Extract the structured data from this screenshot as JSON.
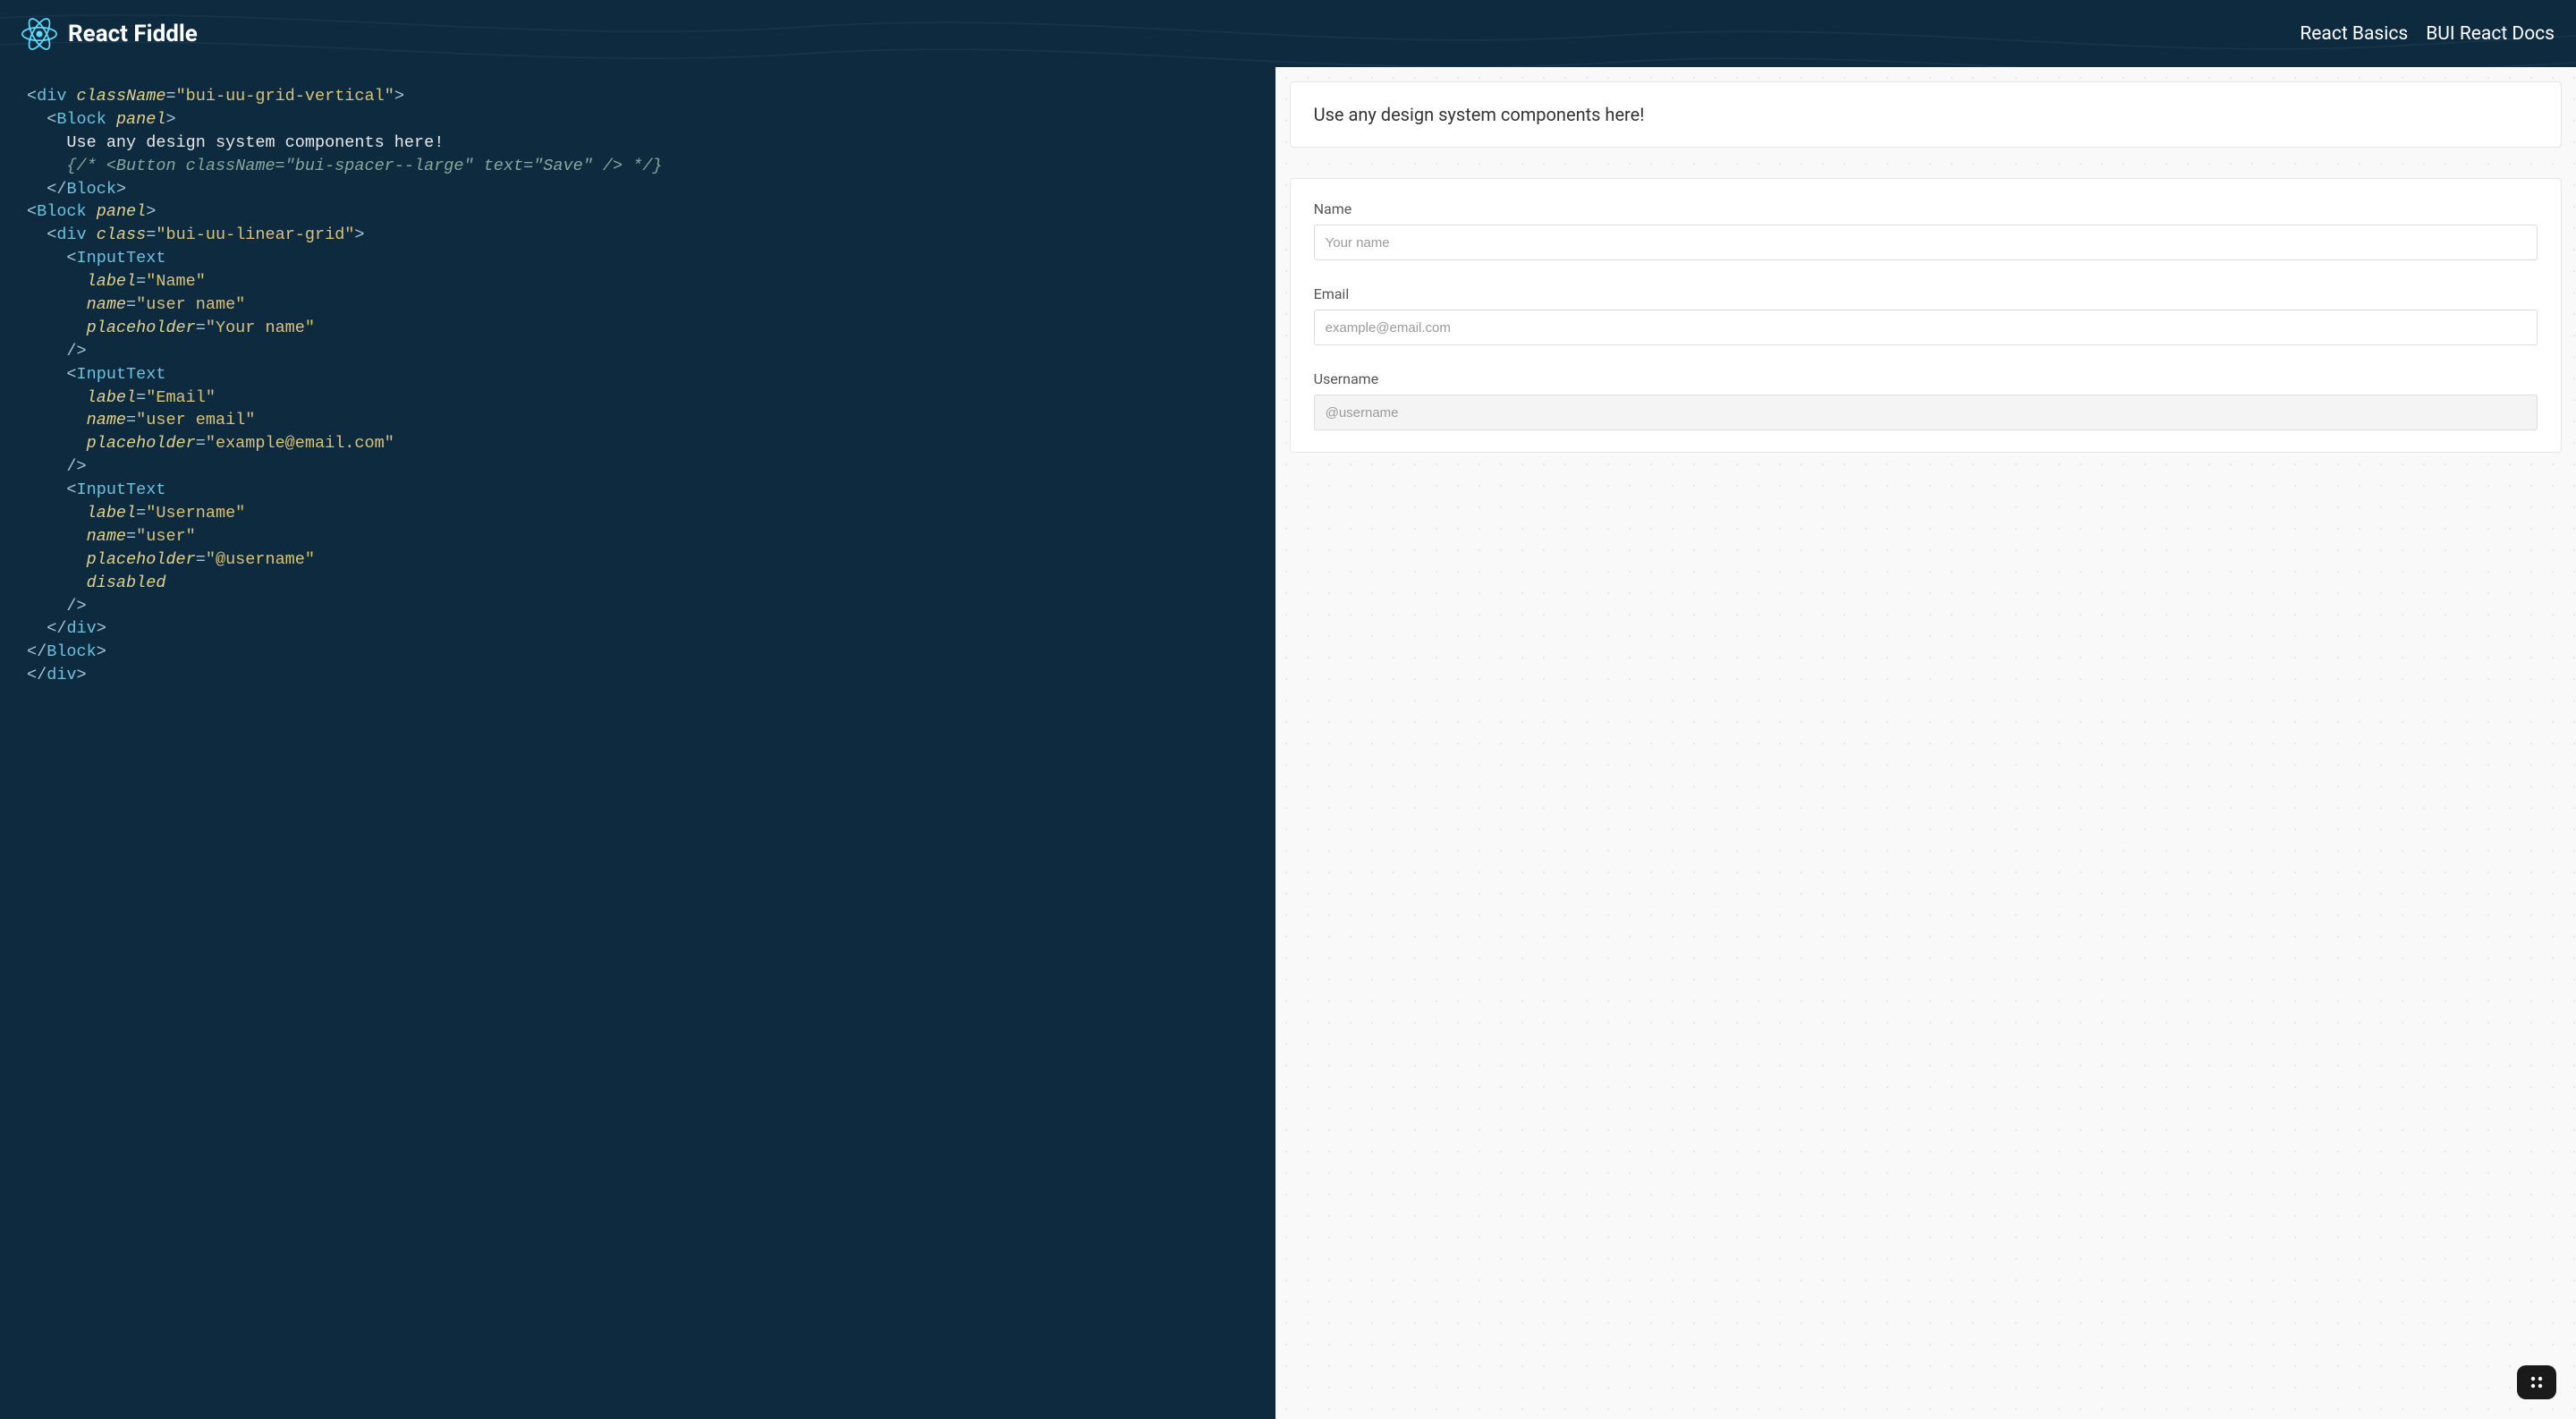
{
  "header": {
    "title": "React Fiddle",
    "nav": [
      {
        "label": "React Basics"
      },
      {
        "label": "BUI React Docs"
      }
    ]
  },
  "code": {
    "line1_class": "\"bui-uu-grid-vertical\"",
    "block_text": "Use any design system components here!",
    "comment": "{/* <Button className=\"bui-spacer--large\" text=\"Save\" /> */}",
    "linear_grid_class": "\"bui-uu-linear-grid\"",
    "input1_label": "\"Name\"",
    "input1_name": "\"user name\"",
    "input1_placeholder": "\"Your name\"",
    "input2_label": "\"Email\"",
    "input2_name": "\"user email\"",
    "input2_placeholder": "\"example@email.com\"",
    "input3_label": "\"Username\"",
    "input3_name": "\"user\"",
    "input3_placeholder": "\"@username\""
  },
  "preview": {
    "panel1_text": "Use any design system components here!",
    "fields": [
      {
        "label": "Name",
        "placeholder": "Your name",
        "disabled": false
      },
      {
        "label": "Email",
        "placeholder": "example@email.com",
        "disabled": false
      },
      {
        "label": "Username",
        "placeholder": "@username",
        "disabled": true
      }
    ]
  }
}
